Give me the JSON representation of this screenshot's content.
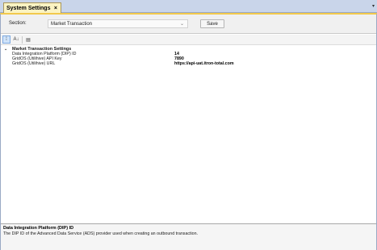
{
  "tab": {
    "title": "System Settings",
    "close": "×",
    "menu": "▾"
  },
  "section": {
    "label": "Section:",
    "selected": "Market Transaction",
    "save_label": "Save"
  },
  "toolbar": {
    "categorized": "⁞",
    "alphabetical": "A↓",
    "pages": "▤"
  },
  "grid": {
    "category": "Market Transaction Settings",
    "rows": [
      {
        "name": "Data Integration Platform (DIP) ID",
        "value": "14"
      },
      {
        "name": "GridOS (Utilihive) API Key",
        "value": "7890"
      },
      {
        "name": "GridOS (Utilihive) URL",
        "value": "https://api-uat.itron-total.com"
      }
    ]
  },
  "description": {
    "title": "Data Integration Platform (DIP) ID",
    "text": "The DIP ID of the Advanced Data Service (ADS) provider used when creating an outbound transaction."
  },
  "colors": {
    "tab_active": "#fbf3c2",
    "accent": "#f2c94c",
    "chrome": "#c9d5ea"
  }
}
